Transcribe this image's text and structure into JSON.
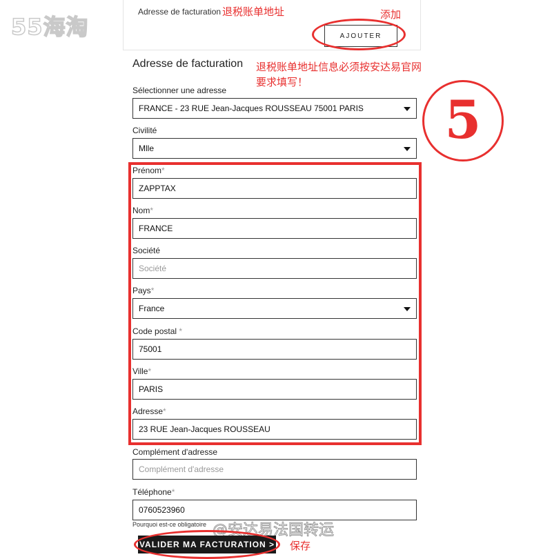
{
  "watermarks": {
    "top_left": "55海淘",
    "bottom": "@安达易法国转运"
  },
  "billing_header": {
    "label": "Adresse de facturation",
    "add_button": "AJOUTER"
  },
  "annotations": {
    "billing_address_note": "退税账单地址",
    "add_note": "添加",
    "fill_note_line1": "退税账单地址信息必须按安达易官网",
    "fill_note_line2": "要求填写！",
    "step_number": "5",
    "save_note": "保存"
  },
  "form": {
    "title": "Adresse de facturation",
    "select_address": {
      "label": "Sélectionner une adresse",
      "value": "FRANCE - 23 RUE Jean-Jacques ROUSSEAU 75001 PARIS"
    },
    "civilite": {
      "label": "Civilité",
      "value": "Mlle"
    },
    "prenom": {
      "label": "Prénom",
      "required": "*",
      "value": "ZAPPTAX"
    },
    "nom": {
      "label": "Nom",
      "required": "*",
      "value": "FRANCE"
    },
    "societe": {
      "label": "Société",
      "placeholder": "Société"
    },
    "pays": {
      "label": "Pays",
      "required": "*",
      "value": "France"
    },
    "code_postal": {
      "label": "Code postal",
      "required": "*",
      "value": "75001"
    },
    "ville": {
      "label": "Ville",
      "required": "*",
      "value": "PARIS"
    },
    "adresse": {
      "label": "Adresse",
      "required": "*",
      "value": "23 RUE Jean-Jacques ROUSSEAU"
    },
    "complement": {
      "label": "Complément d'adresse",
      "placeholder": "Complément d'adresse"
    },
    "telephone": {
      "label": "Téléphone",
      "required": "*",
      "value": "0760523960"
    },
    "phone_note": "Pourquoi est-ce obligatoire",
    "submit_button": "VALIDER MA FACTURATION >"
  },
  "colors": {
    "annotation_red": "#e8302f",
    "button_dark": "#1a1a1a",
    "border": "#333333"
  }
}
